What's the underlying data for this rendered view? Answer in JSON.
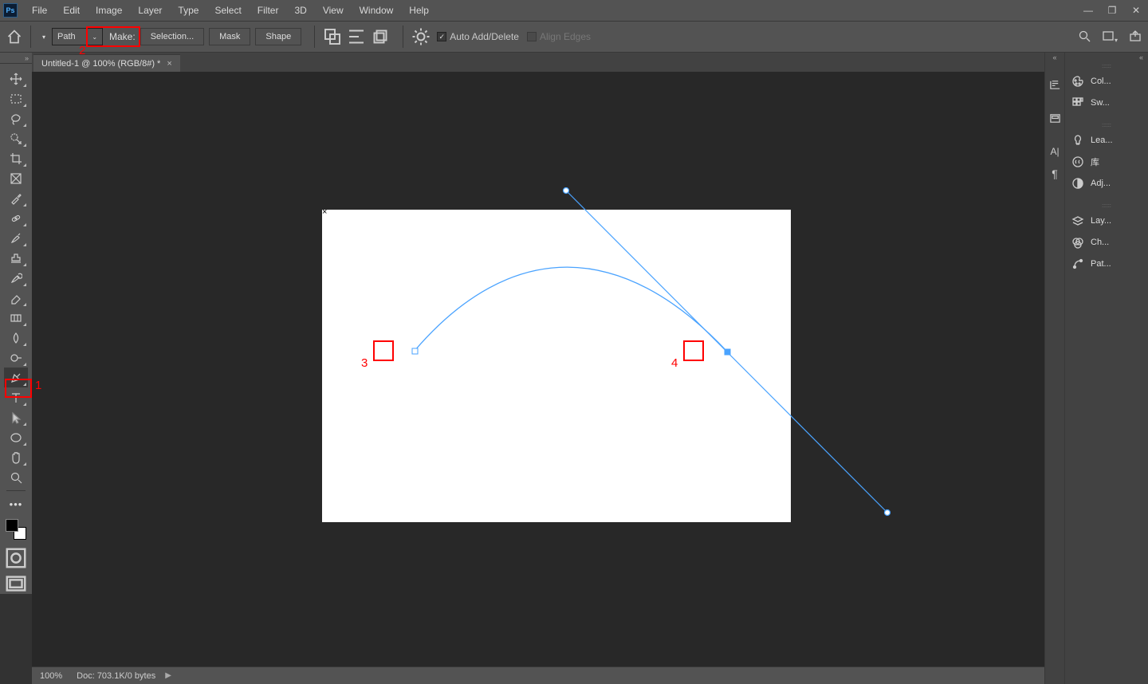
{
  "menu": {
    "items": [
      "File",
      "Edit",
      "Image",
      "Layer",
      "Type",
      "Select",
      "Filter",
      "3D",
      "View",
      "Window",
      "Help"
    ]
  },
  "options": {
    "mode": "Path",
    "make_label": "Make:",
    "selection_btn": "Selection...",
    "mask_btn": "Mask",
    "shape_btn": "Shape",
    "auto_label": "Auto Add/Delete",
    "align_label": "Align Edges"
  },
  "document": {
    "tab_title": "Untitled-1 @ 100% (RGB/8#) *"
  },
  "status": {
    "zoom": "100%",
    "doc_info": "Doc:  703.1K/0 bytes"
  },
  "panels": {
    "items": [
      "Col...",
      "Sw...",
      "Lea...",
      "库",
      "Adj...",
      "Lay...",
      "Ch...",
      "Pat..."
    ]
  },
  "annotations": {
    "l1": "1",
    "l2": "2",
    "l3": "3",
    "l4": "4"
  }
}
